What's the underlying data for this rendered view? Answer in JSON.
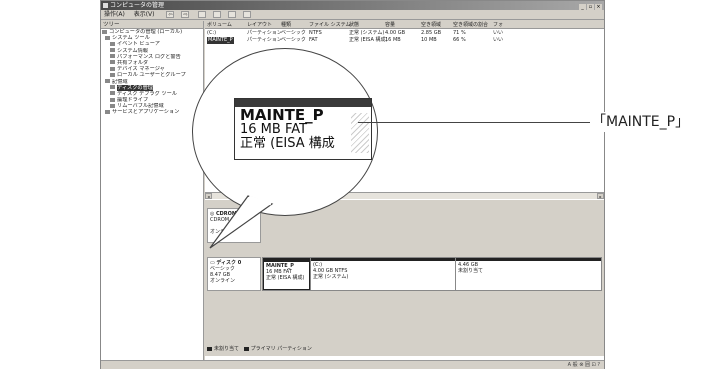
{
  "window": {
    "title": "コンピュータの管理",
    "controls": [
      "_",
      "▫",
      "×"
    ]
  },
  "menubar": {
    "items": [
      "操作(A)",
      "表示(V)"
    ],
    "nav": [
      "⇦",
      "⇨"
    ]
  },
  "tree": {
    "header": "ツリー",
    "items": [
      {
        "label": "コンピュータの管理 (ローカル)",
        "indent": 0
      },
      {
        "label": "システム ツール",
        "indent": 1
      },
      {
        "label": "イベント ビューア",
        "indent": 2
      },
      {
        "label": "システム情報",
        "indent": 2
      },
      {
        "label": "パフォーマンス ログと警告",
        "indent": 2
      },
      {
        "label": "共有フォルダ",
        "indent": 2
      },
      {
        "label": "デバイス マネージャ",
        "indent": 2
      },
      {
        "label": "ローカル ユーザーとグループ",
        "indent": 2
      },
      {
        "label": "記憶域",
        "indent": 1
      },
      {
        "label": "ディスクの管理",
        "indent": 2,
        "selected": true
      },
      {
        "label": "ディスク デフラグ ツール",
        "indent": 2
      },
      {
        "label": "論理ドライブ",
        "indent": 2
      },
      {
        "label": "リムーバブル記憶域",
        "indent": 2
      },
      {
        "label": "サービスとアプリケーション",
        "indent": 1
      }
    ]
  },
  "volume_table": {
    "columns": [
      "ボリューム",
      "レイアウト",
      "種類",
      "ファイル システム",
      "状態",
      "容量",
      "空き領域",
      "空き領域の割合",
      "フォ"
    ],
    "rows": [
      [
        "(C:)",
        "パーティション",
        "ベーシック",
        "NTFS",
        "正常 (システム)",
        "4.00 GB",
        "2.85 GB",
        "71 %",
        "いい"
      ],
      [
        "MAINTE_P",
        "パーティション",
        "ベーシック",
        "FAT",
        "正常 (EISA 構成)",
        "16 MB",
        "10 MB",
        "66 %",
        "いい"
      ]
    ]
  },
  "disks": [
    {
      "name": "CDROM 0",
      "type": "CDROM (D:)",
      "status": "オンライン",
      "partitions": []
    },
    {
      "name": "ディスク 0",
      "type": "ベーシック",
      "size": "8.47 GB",
      "status": "オンライン",
      "partitions": [
        {
          "name": "MAINTE_P",
          "line2": "16 MB FAT",
          "line3": "正常 (EISA 構成)"
        },
        {
          "name": "(C:)",
          "line2": "4.00 GB NTFS",
          "line3": "正常 (システム)"
        },
        {
          "name": "",
          "line2": "4.46 GB",
          "line3": "未割り当て"
        }
      ]
    }
  ],
  "legend": {
    "unallocated": "未割り当て",
    "primary": "プライマリ パーティション"
  },
  "zoom": {
    "line1": "MAINTE_P",
    "line2": "16 MB FAT",
    "line3": "正常 (EISA 構成"
  },
  "callout_label": "「MAINTE_P」",
  "tray": "A 般 ⊗ 囲 ⊡ ?",
  "colors": {
    "window_bg": "#d4d0c8",
    "title_gradient_start": "#4a4a4a",
    "selection": "#333333"
  }
}
